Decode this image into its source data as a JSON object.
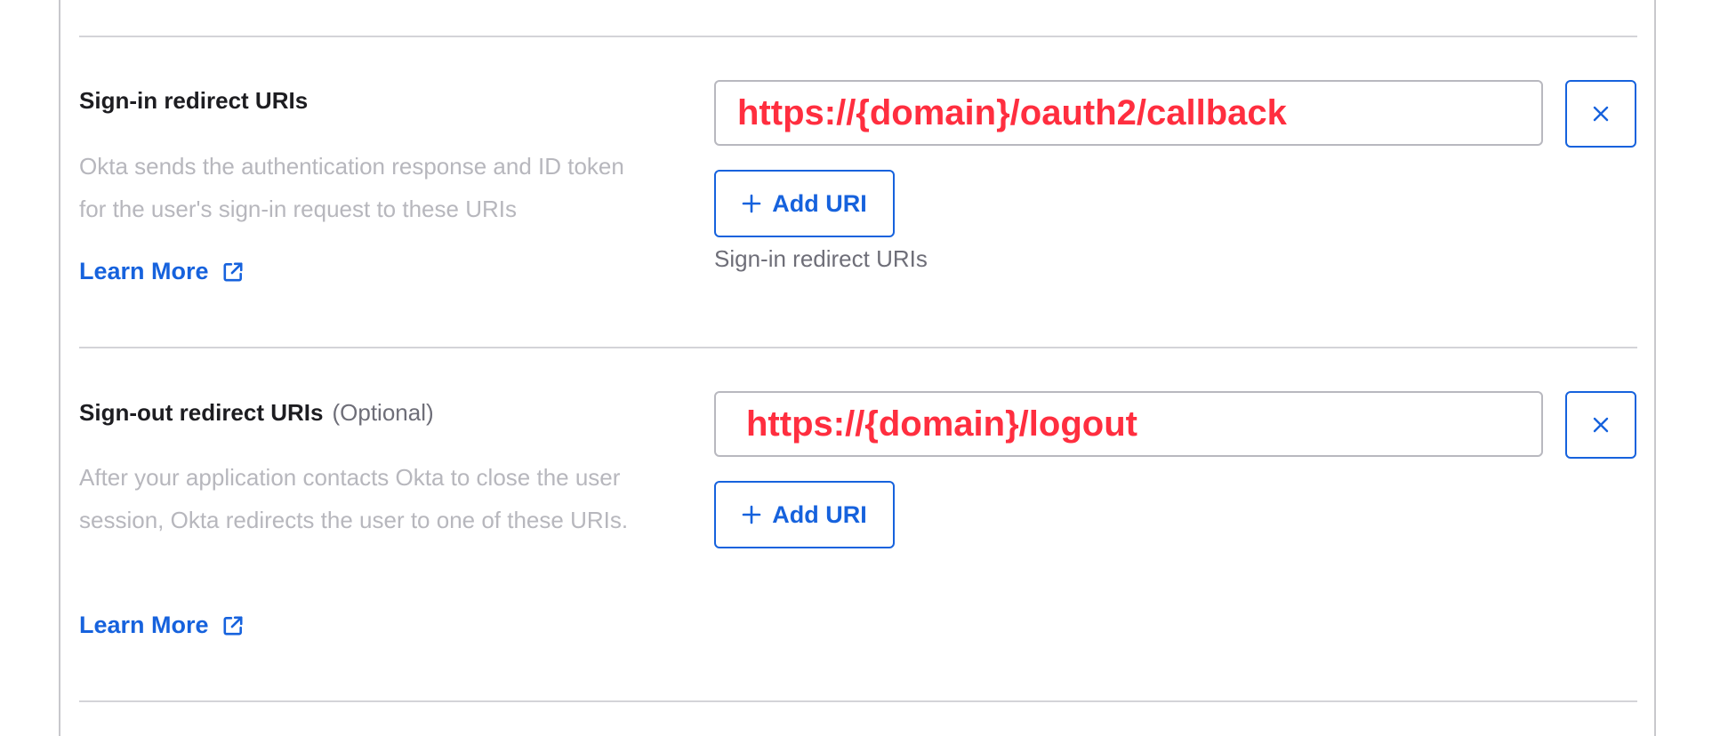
{
  "sign_in": {
    "title": "Sign-in redirect URIs",
    "description": "Okta sends the authentication response and ID token for the user's sign-in request to these URIs",
    "learn_more": "Learn More",
    "uri_value": "https://{domain}/oauth2/callback",
    "add_label": "Add URI",
    "hint": "Sign-in redirect URIs"
  },
  "sign_out": {
    "title": "Sign-out redirect URIs",
    "optional": "(Optional)",
    "description": "After your application contacts Okta to close the user session, Okta redirects the user to one of these URIs.",
    "learn_more": "Learn More",
    "uri_value": "https://{domain}/logout",
    "add_label": "Add URI"
  },
  "icons": {
    "external_link": "external-link-icon",
    "close": "close-icon",
    "plus": "plus-icon"
  },
  "colors": {
    "accent": "#1662dd",
    "uri_text": "#ff2e3f",
    "description": "#b7b7bd",
    "divider": "#d4d4d8"
  }
}
